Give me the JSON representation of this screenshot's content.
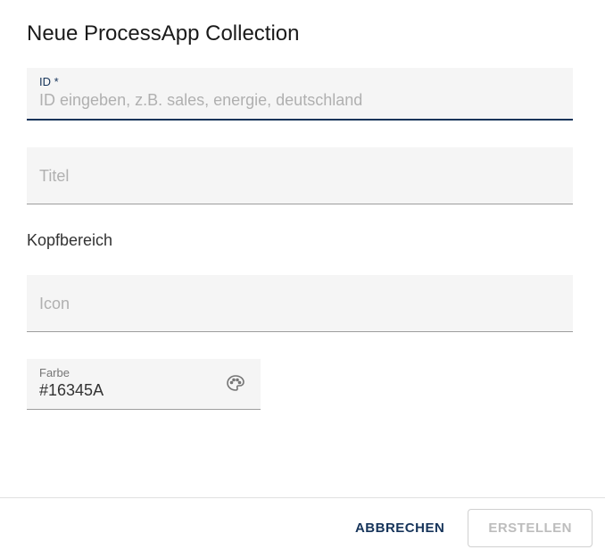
{
  "dialog": {
    "title": "Neue ProcessApp Collection",
    "section_header_label": "Kopfbereich"
  },
  "fields": {
    "id": {
      "label": "ID",
      "required_marker": "*",
      "placeholder": "ID eingeben, z.B. sales, energie, deutschland",
      "value": ""
    },
    "title": {
      "placeholder": "Titel",
      "value": ""
    },
    "icon": {
      "placeholder": "Icon",
      "value": ""
    },
    "color": {
      "label": "Farbe",
      "value": "#16345A"
    }
  },
  "actions": {
    "cancel": "Abbrechen",
    "create": "Erstellen"
  },
  "colors": {
    "accent": "#16345A"
  }
}
